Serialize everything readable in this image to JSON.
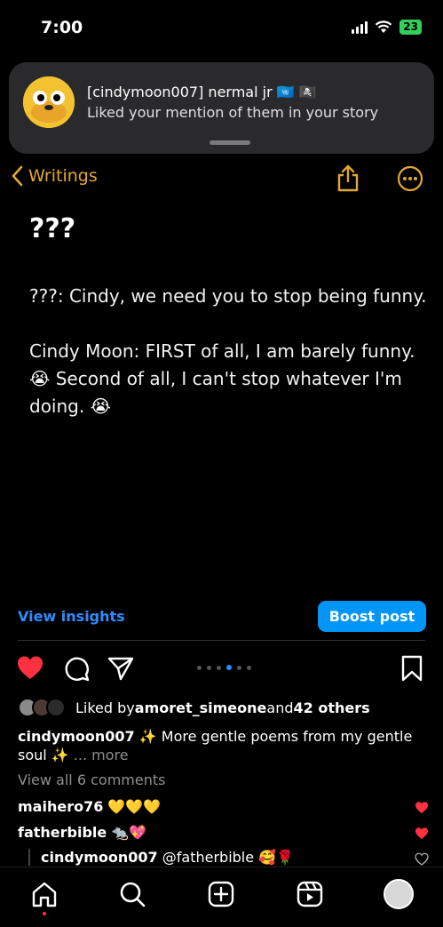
{
  "status": {
    "time": "7:00",
    "battery": "23"
  },
  "notification": {
    "title": "[cindymoon007] nermal jr 🇺🇳 🏴‍☠️",
    "body": "Liked your mention of them in your story"
  },
  "notes": {
    "back_label": "Writings",
    "title": "???",
    "lines": [
      "???: Cindy, we need you to stop being funny.",
      "Cindy Moon: FIRST of all, I am barely funny.",
      "😭 Second of all, I can't stop whatever I'm",
      "doing. 😭"
    ]
  },
  "post": {
    "view_insights": "View insights",
    "boost_post": "Boost post",
    "likes_prefix": "Liked by ",
    "likes_user": "amoret_simeone",
    "likes_and": " and ",
    "likes_others": "42 others",
    "caption_user": "cindymoon007",
    "caption_text": " ✨ More gentle poems from my gentle soul ✨",
    "caption_more": "... more",
    "view_comments": "View all 6 comments",
    "comments": [
      {
        "user": "maihero76",
        "text": " 💛💛💛"
      },
      {
        "user": "fatherbible",
        "text": " 🐀💖"
      }
    ],
    "reply": {
      "user": "cindymoon007",
      "text": " @fatherbible 🥰🌹"
    }
  },
  "colors": {
    "accent_notes": "#e3a833",
    "link_blue": "#2d8cff",
    "like_red": "#ff3040"
  },
  "icons": {
    "status": [
      "signal-icon",
      "wifi-icon",
      "battery-icon"
    ],
    "tabs": [
      "home-icon",
      "search-icon",
      "create-icon",
      "reels-icon",
      "profile-avatar"
    ]
  }
}
